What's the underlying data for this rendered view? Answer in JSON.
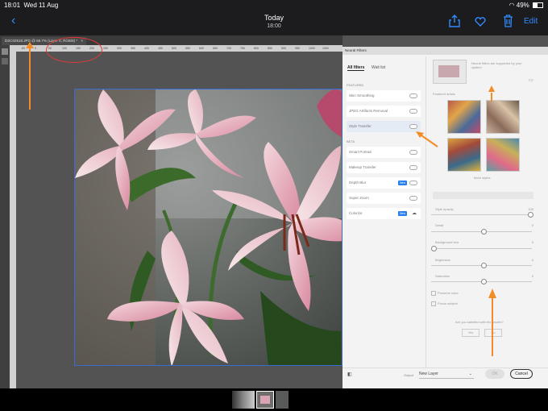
{
  "status": {
    "time": "18:01",
    "date": "Wed 11 Aug",
    "battery": "49%"
  },
  "nav": {
    "title": "Today",
    "subtitle": "18:00",
    "edit": "Edit",
    "icons": [
      "back-chevron-icon",
      "share-icon",
      "heart-icon",
      "trash-icon"
    ]
  },
  "ps": {
    "doc_tab": "DSC02518.JPG @ 66.7% (Layer 0, RGB/8) *",
    "ruler_ticks": [
      "-50",
      "0",
      "50",
      "100",
      "150",
      "200",
      "250",
      "300",
      "350",
      "400",
      "450",
      "500",
      "550",
      "600",
      "650",
      "700",
      "750",
      "800",
      "850",
      "900",
      "950",
      "1000",
      "1050"
    ]
  },
  "neural_filters": {
    "header": "Neural Filters",
    "tab_all": "All filters",
    "tab_wait": "Wait list",
    "section_featured": "FEATURED",
    "section_beta": "BETA",
    "featured": [
      {
        "label": "Skin Smoothing"
      },
      {
        "label": "JPEG Artifacts Removal"
      },
      {
        "label": "Style Transfer"
      }
    ],
    "beta": [
      {
        "label": "Smart Portrait",
        "badge": ""
      },
      {
        "label": "Makeup Transfer",
        "badge": ""
      },
      {
        "label": "Depth Blur",
        "badge": "New"
      },
      {
        "label": "Super Zoom",
        "badge": ""
      },
      {
        "label": "Colorize",
        "badge": "New"
      }
    ],
    "right": {
      "note": "Neural filters are supported by your system",
      "presets_label": "Featured artists",
      "more_styles": "More styles",
      "sliders": [
        {
          "label": "Style opacity",
          "value": "100"
        },
        {
          "label": "Detail",
          "value": "0"
        },
        {
          "label": "Background blur",
          "value": "0"
        },
        {
          "label": "Brightness",
          "value": "0"
        },
        {
          "label": "Saturation",
          "value": "0"
        }
      ],
      "checkbox1": "Preserve color",
      "checkbox2": "Focus subject",
      "feedback": "Are you satisfied with the results?",
      "yes": "Yes",
      "no": "No"
    },
    "footer": {
      "output_label": "Output",
      "output_value": "New Layer",
      "ok": "OK",
      "cancel": "Cancel"
    }
  },
  "colors": {
    "accent": "#2f8cff",
    "annotation": "#f28c28",
    "circle": "#e53935",
    "badge": "#2680eb"
  }
}
